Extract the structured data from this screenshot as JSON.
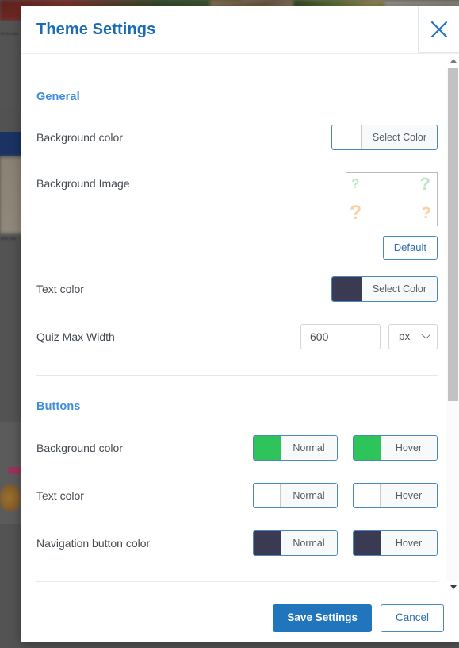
{
  "modal": {
    "title": "Theme Settings",
    "close_icon": "close-icon",
    "sections": [
      {
        "id": "general",
        "heading": "General",
        "rows": [
          {
            "id": "background-color",
            "label": "Background color",
            "control": "color-picker",
            "pickers": [
              {
                "label": "Select Color",
                "swatch": "#ffffff"
              }
            ]
          },
          {
            "id": "background-image",
            "label": "Background Image",
            "control": "image-picker",
            "default_label": "Default",
            "placeholder_glyphs": [
              "?",
              "?",
              "?",
              "?"
            ],
            "glyph_colors": [
              "#5fbe78",
              "#5fbe78",
              "#f5aa5f",
              "#f5aa5f"
            ]
          },
          {
            "id": "text-color",
            "label": "Text color",
            "control": "color-picker",
            "pickers": [
              {
                "label": "Select Color",
                "swatch": "#3a3a52"
              }
            ]
          },
          {
            "id": "quiz-max-width",
            "label": "Quiz Max Width",
            "control": "number-with-unit",
            "value": "600",
            "placeholder": "600",
            "unit": "px"
          }
        ]
      },
      {
        "id": "buttons",
        "heading": "Buttons",
        "rows": [
          {
            "id": "buttons-background-color",
            "label": "Background color",
            "control": "color-picker",
            "pickers": [
              {
                "label": "Normal",
                "swatch": "#2ec35b"
              },
              {
                "label": "Hover",
                "swatch": "#2ec35b"
              }
            ]
          },
          {
            "id": "buttons-text-color",
            "label": "Text color",
            "control": "color-picker",
            "pickers": [
              {
                "label": "Normal",
                "swatch": "#ffffff"
              },
              {
                "label": "Hover",
                "swatch": "#ffffff"
              }
            ]
          },
          {
            "id": "navigation-button-color",
            "label": "Navigation button color",
            "control": "color-picker",
            "pickers": [
              {
                "label": "Normal",
                "swatch": "#3a3a52"
              },
              {
                "label": "Hover",
                "swatch": "#3a3a52"
              }
            ]
          }
        ]
      }
    ],
    "footer": {
      "save_label": "Save Settings",
      "cancel_label": "Cancel"
    },
    "scrollbar": {
      "up_icon": "scroll-up-arrow-icon",
      "down_icon": "scroll-down-arrow-icon"
    }
  },
  "colors": {
    "title_blue": "#1a6bb5",
    "section_blue": "#3d8ddb",
    "primary_button": "#2175bd",
    "link_blue": "#2d6fb0",
    "green_swatch": "#2ec35b",
    "navy_swatch": "#3a3a52",
    "label_text": "#444b52"
  },
  "background": {
    "snippets": [
      "fer to volu",
      "phyr pas"
    ]
  }
}
